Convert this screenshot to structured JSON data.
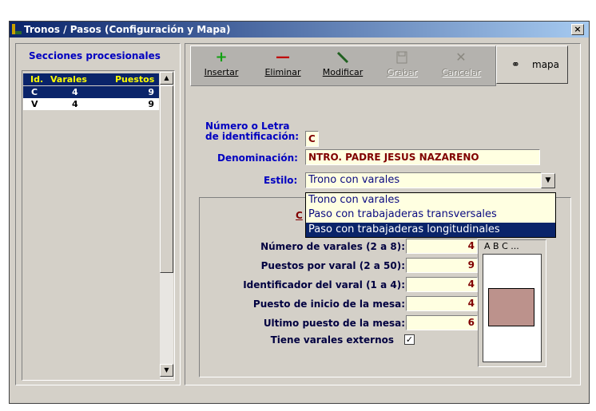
{
  "window": {
    "title": "Tronos / Pasos (Configuración y Mapa)",
    "close": "×"
  },
  "left": {
    "title": "Secciones procesionales",
    "columns": [
      "Id.",
      "Varales",
      "Puestos"
    ],
    "rows": [
      {
        "id": "C",
        "varales": "4",
        "puestos": "9"
      },
      {
        "id": "V",
        "varales": "4",
        "puestos": "9"
      }
    ]
  },
  "toolbar": {
    "insertar": "Insertar",
    "eliminar": "Eliminar",
    "modificar": "Modificar",
    "grabar": "Grabar",
    "cancelar": "Cancelar",
    "mapa": "mapa"
  },
  "form": {
    "numero_label_1": "Número o Letra",
    "numero_label_2": "de identificación:",
    "numero_value": "C",
    "denominacion_label": "Denominación:",
    "denominacion_value": "NTRO. PADRE JESUS NAZARENO",
    "estilo_label": "Estilo:",
    "estilo_value": "Trono con varales",
    "estilo_options": [
      "Trono con varales",
      "Paso con trabajaderas transversales",
      "Paso con trabajaderas longitudinales"
    ]
  },
  "group": {
    "partial_link": "C",
    "preview_label": "A B C ...",
    "fields": [
      {
        "label": "Número de varales (2 a 8):",
        "value": "4"
      },
      {
        "label": "Puestos por varal (2 a 50):",
        "value": "9"
      },
      {
        "label": "Identificador del varal (1 a 4):",
        "value": "4"
      },
      {
        "label": "Puesto de inicio de la mesa:",
        "value": "4"
      },
      {
        "label": "Ultimo puesto de la mesa:",
        "value": "6"
      }
    ],
    "externos_label": "Tiene varales externos",
    "externos_checked": "✓"
  },
  "colors": {
    "titlebar": "#0a246a",
    "selection": "#0a246a",
    "label_blue": "#0000c0",
    "value_red": "#800000",
    "field_bg": "#ffffe1"
  }
}
